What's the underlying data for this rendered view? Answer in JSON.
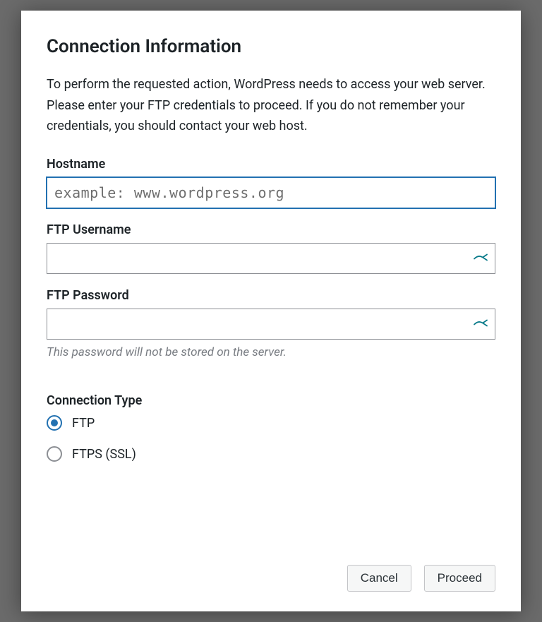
{
  "modal": {
    "title": "Connection Information",
    "description": "To perform the requested action, WordPress needs to access your web server. Please enter your FTP credentials to proceed. If you do not remember your credentials, you should contact your web host.",
    "hostname": {
      "label": "Hostname",
      "placeholder": "example: www.wordpress.org",
      "value": ""
    },
    "username": {
      "label": "FTP Username",
      "value": ""
    },
    "password": {
      "label": "FTP Password",
      "value": "",
      "hint": "This password will not be stored on the server."
    },
    "connection_type": {
      "label": "Connection Type",
      "options": [
        {
          "label": "FTP",
          "checked": true
        },
        {
          "label": "FTPS (SSL)",
          "checked": false
        }
      ]
    },
    "buttons": {
      "cancel": "Cancel",
      "proceed": "Proceed"
    }
  }
}
